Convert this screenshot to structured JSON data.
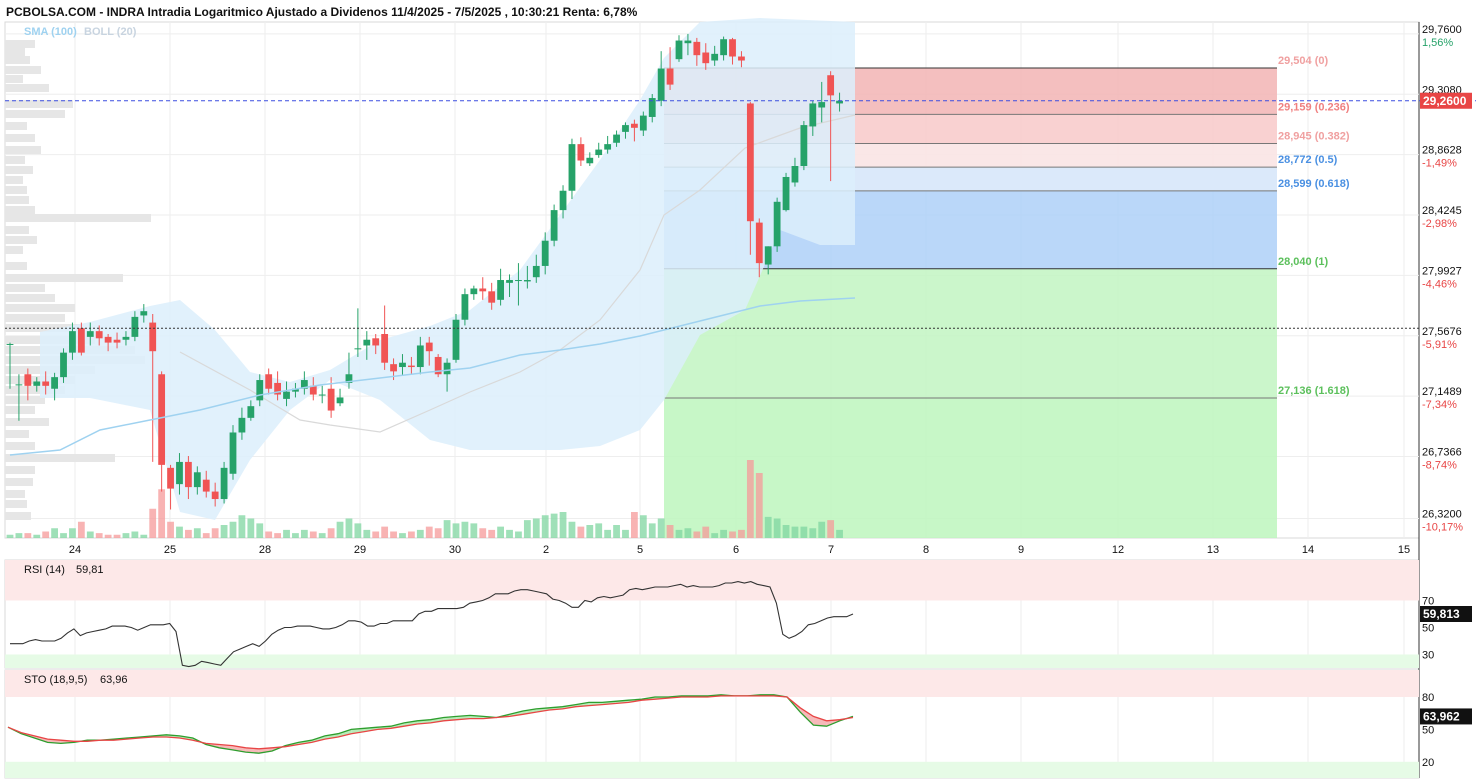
{
  "header": {
    "title": "PCBOLSA.COM - INDRA Intradia Logaritmico Ajustado a Dividenos 11/4/2025 - 7/5/2025 , 10:30:21 Renta: 6,78%",
    "legend_sma": "SMA (100)",
    "legend_boll": "BOLL (20)"
  },
  "colors": {
    "up": "#26a269",
    "down": "#f05454",
    "sma": "#9fd2f0",
    "boll_fill": "#dceefb",
    "fib_red": "#f2b4b4",
    "fib_blue": "#a9cdf7",
    "fib_green": "#c2f5c2",
    "current": "#e84545"
  },
  "chart_data": [
    {
      "type": "candlestick",
      "scale": "log",
      "ylim": [
        26.19,
        29.85
      ],
      "x_ticks": [
        "24",
        "25",
        "28",
        "29",
        "30",
        "2",
        "5",
        "6",
        "7",
        "8",
        "9",
        "12",
        "13",
        "14",
        "15"
      ],
      "y_ticks": [
        {
          "value": "29,7600",
          "pct": "1,56%"
        },
        {
          "value": "29,3080",
          "pct": ""
        },
        {
          "value": "28,8628",
          "pct": "-1,49%"
        },
        {
          "value": "28,4245",
          "pct": "-2,98%"
        },
        {
          "value": "27,9927",
          "pct": "-4,46%"
        },
        {
          "value": "27,5676",
          "pct": "-5,91%"
        },
        {
          "value": "27,1489",
          "pct": "-7,34%"
        },
        {
          "value": "26,7366",
          "pct": "-8,74%"
        },
        {
          "value": "26,3200",
          "pct": "-10,17%"
        }
      ],
      "current_price": "29,2600",
      "reference_price": 27.62,
      "fibonacci": [
        {
          "label": "29,504 (0)",
          "value": 29.504
        },
        {
          "label": "29,159 (0.236)",
          "value": 29.159
        },
        {
          "label": "28,945 (0.382)",
          "value": 28.945
        },
        {
          "label": "28,772 (0.5)",
          "value": 28.772
        },
        {
          "label": "28,599 (0.618)",
          "value": 28.599
        },
        {
          "label": "28,040 (1)",
          "value": 28.04
        },
        {
          "label": "27,136 (1.618)",
          "value": 27.136
        }
      ],
      "candles": [
        [
          27.51,
          27.51,
          27.52,
          27.2
        ],
        [
          27.23,
          27.23,
          27.3,
          26.98
        ],
        [
          27.3,
          27.22,
          27.34,
          27.12
        ],
        [
          27.22,
          27.25,
          27.28,
          27.18
        ],
        [
          27.25,
          27.22,
          27.32,
          27.16
        ],
        [
          27.2,
          27.28,
          27.31,
          27.12
        ],
        [
          27.28,
          27.45,
          27.48,
          27.24
        ],
        [
          27.45,
          27.6,
          27.66,
          27.4
        ],
        [
          27.62,
          27.45,
          27.66,
          27.43
        ],
        [
          27.56,
          27.6,
          27.66,
          27.5
        ],
        [
          27.6,
          27.55,
          27.64,
          27.5
        ],
        [
          27.56,
          27.52,
          27.58,
          27.46
        ],
        [
          27.54,
          27.52,
          27.59,
          27.48
        ],
        [
          27.54,
          27.56,
          27.6,
          27.5
        ],
        [
          27.56,
          27.7,
          27.74,
          27.53
        ],
        [
          27.71,
          27.74,
          27.79,
          27.66
        ],
        [
          27.66,
          27.46,
          27.72,
          26.7
        ],
        [
          27.3,
          26.68,
          27.32,
          26.5
        ],
        [
          26.66,
          26.52,
          26.68,
          26.38
        ],
        [
          26.55,
          26.7,
          26.76,
          26.48
        ],
        [
          26.7,
          26.53,
          26.74,
          26.45
        ],
        [
          26.53,
          26.63,
          26.67,
          26.48
        ],
        [
          26.58,
          26.5,
          26.64,
          26.46
        ],
        [
          26.5,
          26.45,
          26.56,
          26.4
        ],
        [
          26.45,
          26.66,
          26.7,
          26.42
        ],
        [
          26.62,
          26.9,
          26.95,
          26.58
        ],
        [
          26.9,
          27.0,
          27.07,
          26.85
        ],
        [
          27.0,
          27.08,
          27.12,
          26.98
        ],
        [
          27.12,
          27.26,
          27.3,
          27.08
        ],
        [
          27.3,
          27.2,
          27.34,
          27.16
        ],
        [
          27.24,
          27.16,
          27.32,
          27.12
        ],
        [
          27.13,
          27.18,
          27.25,
          27.08
        ],
        [
          27.18,
          27.2,
          27.24,
          27.14
        ],
        [
          27.2,
          27.26,
          27.32,
          27.16
        ],
        [
          27.22,
          27.16,
          27.28,
          27.12
        ],
        [
          27.16,
          27.16,
          27.22,
          27.1
        ],
        [
          27.2,
          27.05,
          27.28,
          27.0
        ],
        [
          27.1,
          27.14,
          27.2,
          27.08
        ],
        [
          27.24,
          27.3,
          27.45,
          27.2
        ],
        [
          27.48,
          27.48,
          27.76,
          27.42
        ],
        [
          27.5,
          27.54,
          27.6,
          27.4
        ],
        [
          27.55,
          27.5,
          27.58,
          27.44
        ],
        [
          27.58,
          27.38,
          27.78,
          27.33
        ],
        [
          27.37,
          27.32,
          27.41,
          27.26
        ],
        [
          27.35,
          27.38,
          27.44,
          27.29
        ],
        [
          27.36,
          27.35,
          27.42,
          27.3
        ],
        [
          27.35,
          27.5,
          27.56,
          27.3
        ],
        [
          27.52,
          27.46,
          27.56,
          27.36
        ],
        [
          27.42,
          27.3,
          27.44,
          27.28
        ],
        [
          27.3,
          27.38,
          27.41,
          27.18
        ],
        [
          27.4,
          27.68,
          27.72,
          27.38
        ],
        [
          27.68,
          27.86,
          27.9,
          27.64
        ],
        [
          27.86,
          27.9,
          27.92,
          27.82
        ],
        [
          27.9,
          27.88,
          27.98,
          27.82
        ],
        [
          27.88,
          27.8,
          27.94,
          27.75
        ],
        [
          27.82,
          27.96,
          28.04,
          27.78
        ],
        [
          27.94,
          27.96,
          28.0,
          27.84
        ],
        [
          27.96,
          27.96,
          28.08,
          27.78
        ],
        [
          27.95,
          27.96,
          28.06,
          27.9
        ],
        [
          27.98,
          28.06,
          28.14,
          27.94
        ],
        [
          28.06,
          28.24,
          28.3,
          28.0
        ],
        [
          28.24,
          28.46,
          28.5,
          28.2
        ],
        [
          28.46,
          28.6,
          28.64,
          28.4
        ],
        [
          28.6,
          28.94,
          28.98,
          28.54
        ],
        [
          28.94,
          28.82,
          28.99,
          28.78
        ],
        [
          28.8,
          28.84,
          28.88,
          28.78
        ],
        [
          28.86,
          28.9,
          28.95,
          28.84
        ],
        [
          28.9,
          28.94,
          29.0,
          28.87
        ],
        [
          28.95,
          29.01,
          29.04,
          28.92
        ],
        [
          29.03,
          29.08,
          29.1,
          28.98
        ],
        [
          29.09,
          29.06,
          29.12,
          28.96
        ],
        [
          29.04,
          29.15,
          29.18,
          29.0
        ],
        [
          29.14,
          29.28,
          29.31,
          29.1
        ],
        [
          29.26,
          29.5,
          29.63,
          29.22
        ],
        [
          29.5,
          29.38,
          29.66,
          29.34
        ],
        [
          29.57,
          29.71,
          29.75,
          29.55
        ],
        [
          29.69,
          29.71,
          29.76,
          29.6
        ],
        [
          29.7,
          29.6,
          29.73,
          29.52
        ],
        [
          29.62,
          29.54,
          29.69,
          29.49
        ],
        [
          29.56,
          29.61,
          29.67,
          29.52
        ],
        [
          29.6,
          29.72,
          29.74,
          29.56
        ],
        [
          29.72,
          29.59,
          29.73,
          29.53
        ],
        [
          29.59,
          29.56,
          29.63,
          29.51
        ],
        [
          29.24,
          28.38,
          29.25,
          28.14
        ],
        [
          28.37,
          28.08,
          28.4,
          27.98
        ],
        [
          28.07,
          28.2,
          28.2,
          28.0
        ],
        [
          28.2,
          28.52,
          28.55,
          28.16
        ],
        [
          28.46,
          28.7,
          28.73,
          28.45
        ],
        [
          28.66,
          28.78,
          28.84,
          28.63
        ],
        [
          28.78,
          29.08,
          29.11,
          28.75
        ],
        [
          29.07,
          29.24,
          29.26,
          29.0
        ],
        [
          29.21,
          29.25,
          29.4,
          29.1
        ],
        [
          29.45,
          29.3,
          29.48,
          28.67
        ],
        [
          29.24,
          29.26,
          29.32,
          29.18
        ]
      ],
      "volume": [
        2,
        3,
        3,
        2,
        4,
        6,
        3,
        6,
        10,
        4,
        3,
        2,
        2,
        3,
        4,
        2,
        18,
        30,
        10,
        7,
        5,
        6,
        3,
        6,
        8,
        10,
        14,
        12,
        9,
        4,
        3,
        5,
        3,
        5,
        4,
        3,
        6,
        10,
        12,
        9,
        5,
        4,
        7,
        4,
        3,
        4,
        5,
        7,
        6,
        11,
        9,
        10,
        9,
        6,
        5,
        7,
        5,
        4,
        11,
        12,
        14,
        15,
        16,
        10,
        7,
        8,
        9,
        5,
        8,
        5,
        16,
        14,
        9,
        12,
        8,
        5,
        6,
        4,
        7,
        3,
        5,
        4,
        5,
        48,
        40,
        13,
        12,
        8,
        7,
        7,
        6,
        10,
        11,
        5
      ]
    },
    {
      "type": "line",
      "label": "RSI (14)",
      "last": "59,81",
      "last_badge": "59,813",
      "ylim": [
        20,
        100
      ],
      "levels": [
        70,
        50,
        30
      ],
      "values": [
        38,
        38,
        38,
        40,
        41,
        40,
        40,
        40,
        42,
        46,
        49,
        44,
        46,
        47,
        48,
        49,
        51,
        51,
        51,
        50,
        48,
        50,
        52,
        52,
        52,
        53,
        47,
        22,
        21,
        22,
        25,
        24,
        23,
        22,
        27,
        32,
        34,
        36,
        38,
        36,
        40,
        45,
        48,
        50,
        50,
        51,
        51,
        51,
        50,
        49,
        49,
        50,
        52,
        55,
        55,
        54,
        51,
        51,
        53,
        53,
        55,
        55,
        55,
        55,
        60,
        62,
        62,
        64,
        64,
        64,
        64,
        65,
        68,
        69,
        70,
        72,
        75,
        75,
        75,
        77,
        78,
        78,
        77,
        76,
        75,
        71,
        70,
        68,
        65,
        65,
        70,
        69,
        72,
        73,
        72,
        73,
        74,
        78,
        79,
        78,
        79,
        80,
        80,
        80,
        81,
        82,
        80,
        81,
        80,
        80,
        80,
        81,
        83,
        83,
        84,
        83,
        84,
        82,
        81,
        80,
        68,
        45,
        42,
        44,
        47,
        52,
        53,
        55,
        57,
        58,
        58,
        58,
        60
      ]
    },
    {
      "type": "line",
      "label": "STO (18,9,5)",
      "last": "63,96",
      "last_badge": "63,962",
      "ylim": [
        5,
        105
      ],
      "levels": [
        80,
        50,
        20
      ],
      "series": [
        {
          "name": "",
          "values": [
            52,
            46,
            42,
            38,
            37,
            38,
            40,
            40,
            41,
            42,
            43,
            44,
            45,
            44,
            42,
            36,
            33,
            31,
            29,
            28,
            30,
            35,
            38,
            40,
            44,
            46,
            50,
            51,
            52,
            53,
            56,
            58,
            59,
            61,
            62,
            63,
            62,
            61,
            64,
            67,
            69,
            70,
            71,
            73,
            75,
            75,
            76,
            77,
            78,
            80,
            80,
            81,
            81,
            81,
            82,
            81,
            81,
            82,
            82,
            80,
            66,
            54,
            53,
            58,
            62
          ]
        },
        {
          "name": "",
          "values": [
            52,
            47,
            44,
            41,
            40,
            39,
            39,
            40,
            40,
            41,
            42,
            43,
            43,
            42,
            40,
            37,
            36,
            35,
            33,
            32,
            33,
            34,
            36,
            38,
            41,
            43,
            46,
            48,
            50,
            51,
            53,
            55,
            56,
            58,
            59,
            60,
            60,
            61,
            62,
            64,
            66,
            68,
            69,
            71,
            72,
            73,
            74,
            75,
            77,
            78,
            79,
            80,
            80,
            80,
            81,
            81,
            81,
            81,
            81,
            80,
            70,
            62,
            58,
            59,
            61
          ]
        }
      ]
    }
  ]
}
